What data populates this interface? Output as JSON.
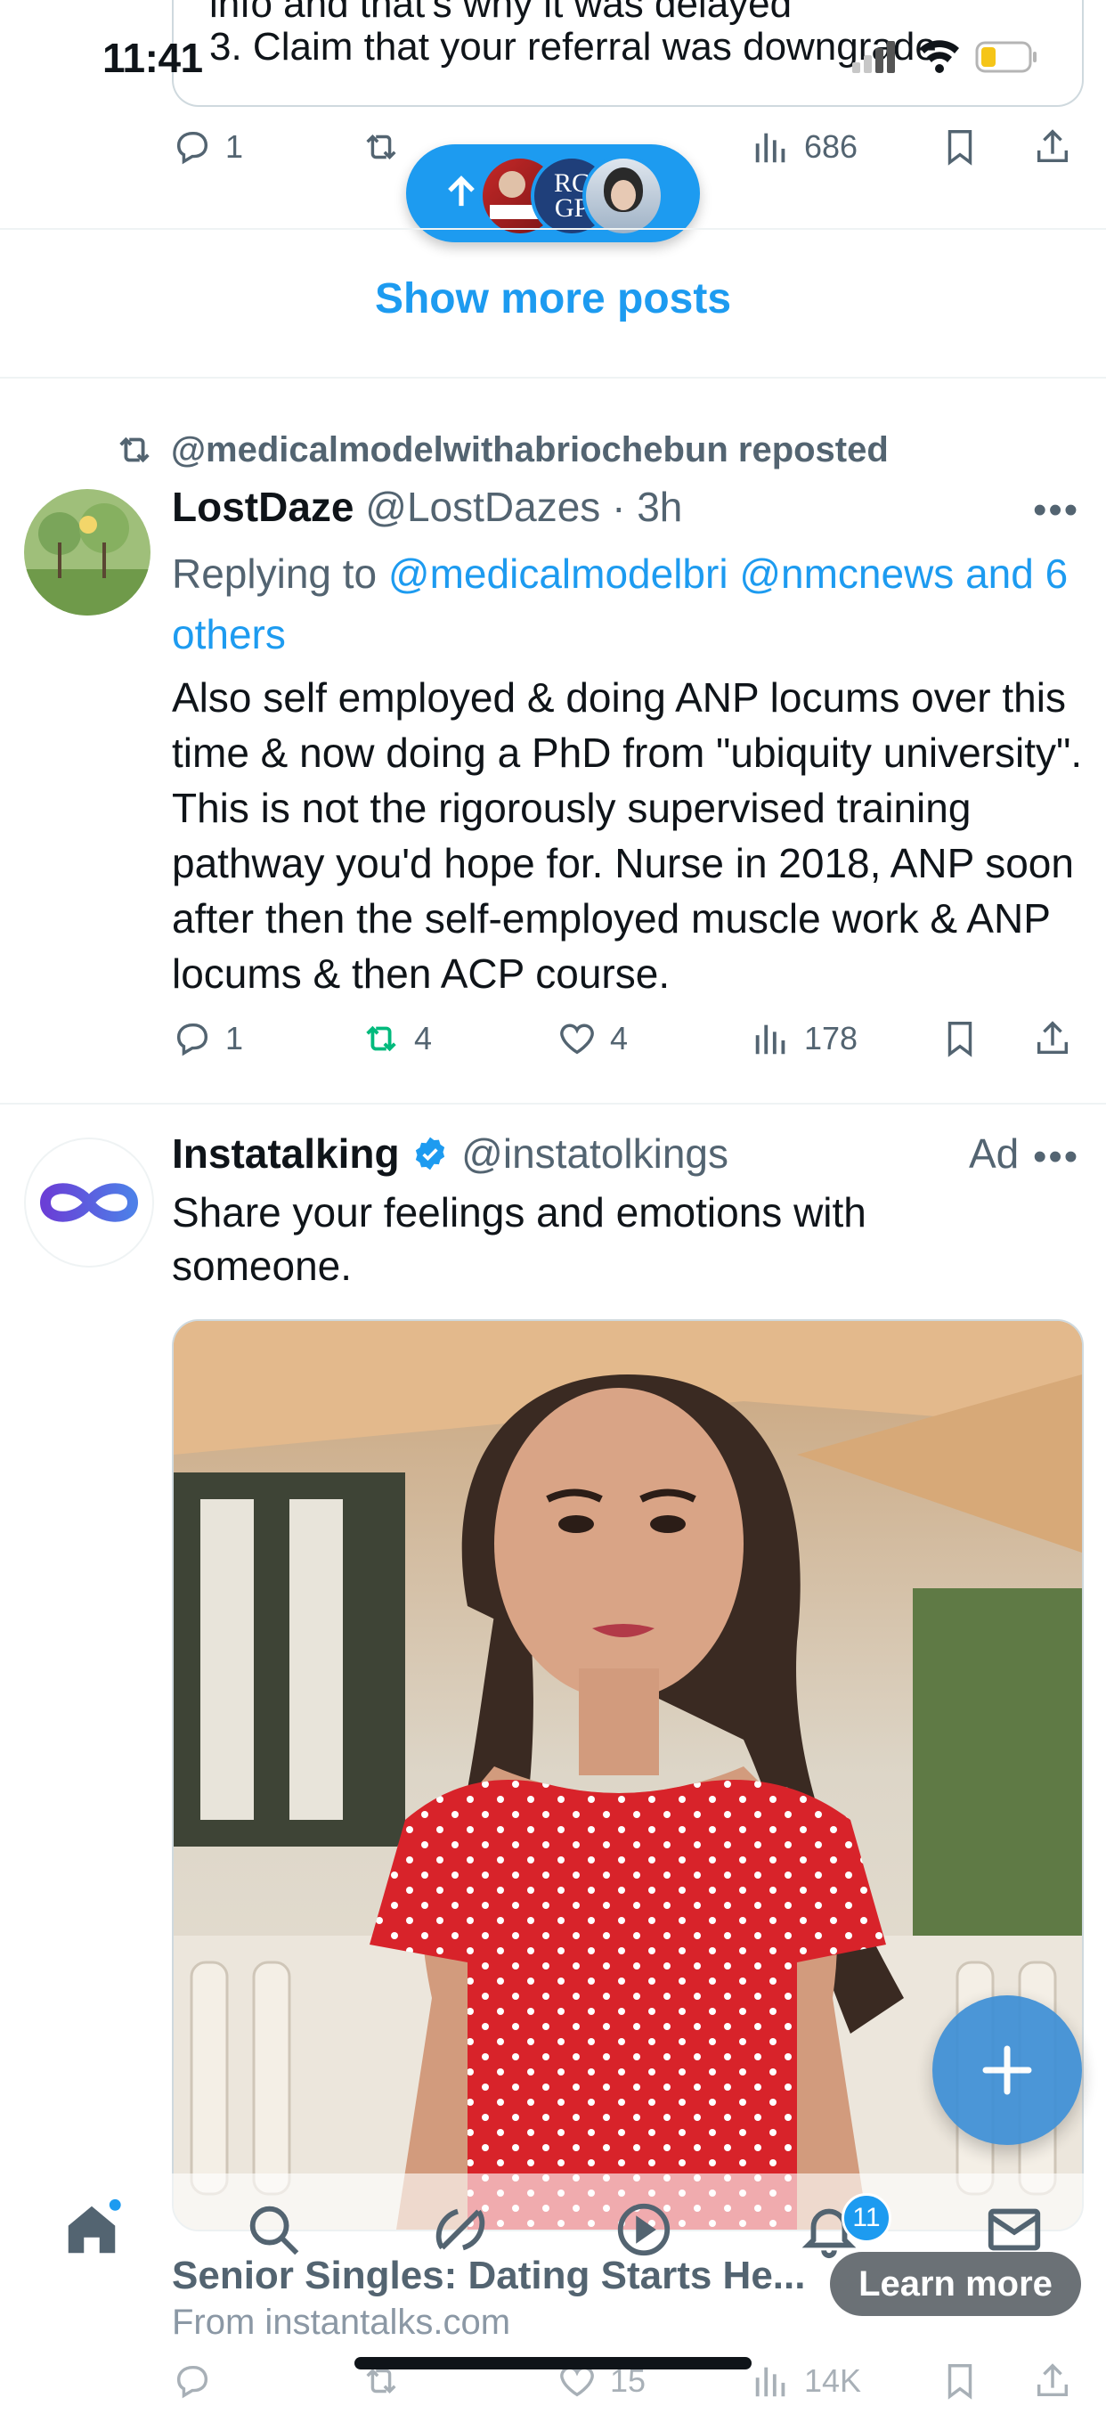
{
  "status_bar": {
    "time": "11:41"
  },
  "top_tweet": {
    "text_line_1": "info and that's why it was delayed",
    "text_line_2": "3. Claim that your referral was downgrade",
    "replies": "1",
    "views": "686"
  },
  "new_posts_pill": {
    "avatar_2_text": "RC GP"
  },
  "show_more": "Show more posts",
  "repost_tweet": {
    "reposted_by": "@medicalmodelwithabriochebun reposted",
    "display_name": "LostDaze",
    "handle": "@LostDazes",
    "time": "3h",
    "replying_prefix": "Replying to",
    "replying_targets": "@medicalmodelbri @nmcnews and 6 others",
    "text": "Also self employed & doing ANP locums over this time & now doing a PhD from \"ubiquity university\". This is not the rigorously supervised training pathway you'd hope for. Nurse in 2018, ANP soon after then the self-employed muscle work & ANP locums & then ACP course.",
    "replies": "1",
    "reposts": "4",
    "likes": "4",
    "views": "178"
  },
  "ad_tweet": {
    "display_name": "Instatalking",
    "handle": "@instatolkings",
    "ad_label": "Ad",
    "text": "Share your feelings and emotions with someone."
  },
  "promo": {
    "title": "Senior Singles: Dating Starts He...",
    "source": "From instantalks.com",
    "cta": "Learn more"
  },
  "bottom_peek": {
    "likes": "15",
    "views": "14K"
  },
  "tab_bar": {
    "notification_count": "11"
  },
  "colors": {
    "accent": "#1d9bf0",
    "repost_green": "#00ba7c",
    "muted": "#536471"
  }
}
